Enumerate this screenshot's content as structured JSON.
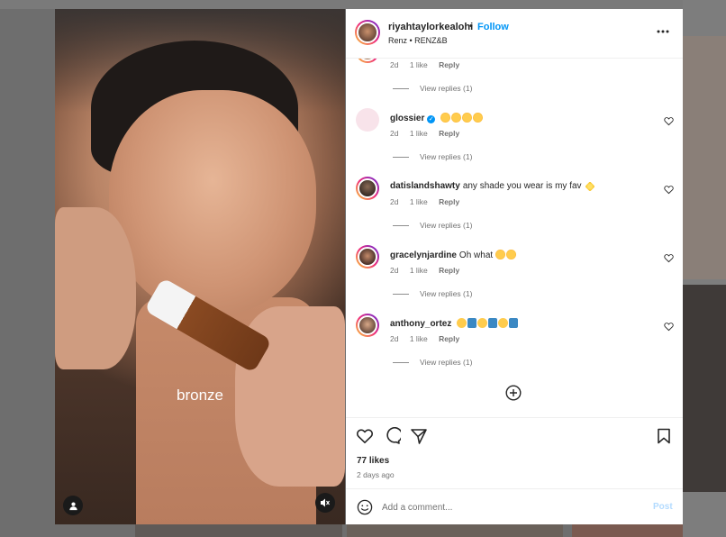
{
  "media": {
    "caption": "bronze",
    "icons": {
      "user_tag": "person-icon",
      "mute": "speaker-muted-icon"
    }
  },
  "header": {
    "username": "riyahtaylorkealohi",
    "separator": "•",
    "follow_label": "Follow",
    "audio": "Renz • RENZ&B",
    "more_icon": "more-horizontal-icon"
  },
  "comments": [
    {
      "username": "",
      "text": "",
      "age": "2d",
      "likes": "1 like",
      "reply_label": "Reply",
      "view_replies": "View replies (1)",
      "partial": true
    },
    {
      "username": "glossier",
      "verified": true,
      "text": "",
      "emoji": [
        "star-struck",
        "star-struck",
        "star-struck",
        "star-struck"
      ],
      "age": "2d",
      "likes": "1 like",
      "reply_label": "Reply",
      "view_replies": "View replies (1)"
    },
    {
      "username": "datislandshawty",
      "text": "any shade you wear is my fav",
      "emoji": [
        "sparkles"
      ],
      "age": "2d",
      "likes": "1 like",
      "reply_label": "Reply",
      "view_replies": "View replies (1)"
    },
    {
      "username": "gracelynjardine",
      "text": "Oh what",
      "emoji": [
        "star-struck",
        "star-struck"
      ],
      "age": "2d",
      "likes": "1 like",
      "reply_label": "Reply",
      "view_replies": "View replies (1)"
    },
    {
      "username": "anthony_ortez",
      "text": "",
      "emoji": [
        "smile",
        "exclamation",
        "smile",
        "exclamation",
        "smile",
        "exclamation"
      ],
      "age": "2d",
      "likes": "1 like",
      "reply_label": "Reply",
      "view_replies": "View replies (1)"
    }
  ],
  "actions": {
    "likes": "77 likes",
    "posted": "2 days ago",
    "icons": [
      "heart-icon",
      "comment-icon",
      "share-icon",
      "bookmark-icon"
    ]
  },
  "add_comment": {
    "placeholder": "Add a comment...",
    "post_label": "Post"
  },
  "colors": {
    "follow": "#0095f6",
    "post_disabled": "#b3dbff",
    "muted_text": "#737373"
  }
}
